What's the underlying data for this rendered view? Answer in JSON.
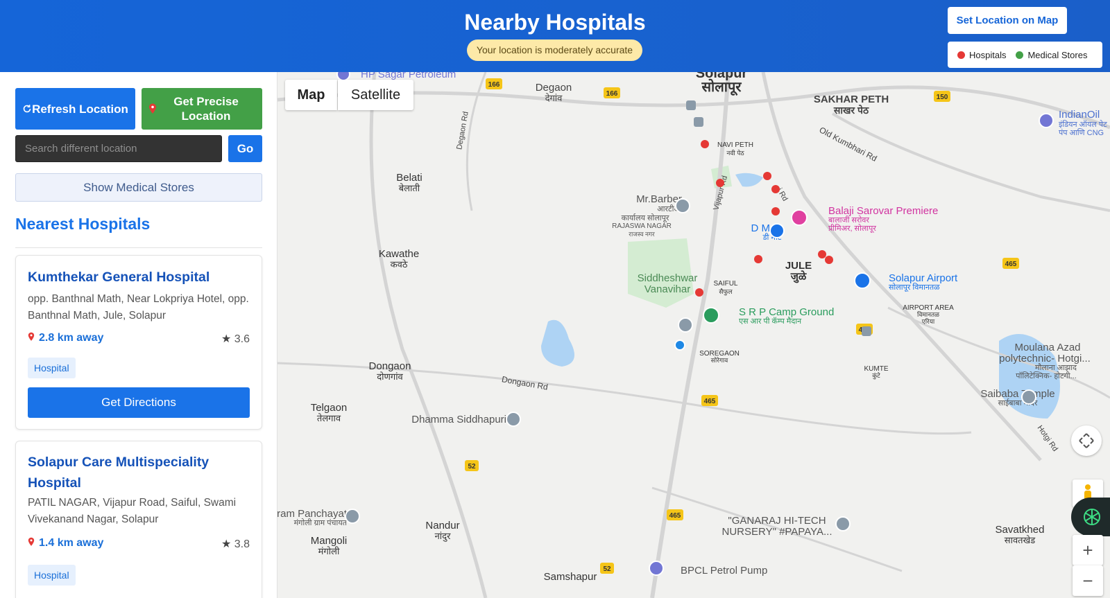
{
  "header": {
    "title": "Nearby Hospitals",
    "accuracy": "Your location is moderately accurate",
    "set_location_button": "Set Location on Map",
    "legend": [
      {
        "label": "Hospitals",
        "color": "#e53935"
      },
      {
        "label": "Medical Stores",
        "color": "#43a047"
      }
    ]
  },
  "sidebar": {
    "refresh_button": "Refresh Location",
    "precise_button": "Get Precise Location",
    "search_placeholder": "Search different location",
    "go_button": "Go",
    "show_stores_button": "Show Medical Stores",
    "section_title": "Nearest Hospitals",
    "hospitals": [
      {
        "name": "Kumthekar General Hospital",
        "address": "opp. Banthnal Math, Near Lokpriya Hotel, opp. Banthnal Math, Jule, Solapur",
        "distance": "2.8 km away",
        "rating": "3.6",
        "tag": "Hospital",
        "directions_button": "Get Directions"
      },
      {
        "name": "Solapur Care Multispeciality Hospital",
        "address": "PATIL NAGAR, Vijapur Road, Saiful, Swami Vivekanand Nagar, Solapur",
        "distance": "1.4 km away",
        "rating": "3.8",
        "tag": "Hospital"
      }
    ]
  },
  "map": {
    "type_buttons": [
      "Map",
      "Satellite"
    ],
    "places": {
      "hp_sagar": "HP Sagar Petroleum",
      "solapur_en": "Solapur",
      "solapur_mr": "सोलापूर",
      "degaon_en": "Degaon",
      "degaon_mr": "देगांव",
      "sakhar_peth_en": "SAKHAR PETH",
      "sakhar_peth_mr": "साखर पेठ",
      "indianoil": "IndianOil",
      "indianoil_mr1": "इंडियन ऑयल पेट",
      "indianoil_mr2": "पंप आणि CNG",
      "navi_peth_en": "NAVI PETH",
      "navi_peth_mr": "नवी पेठ",
      "belati_en": "Belati",
      "belati_mr": "बेलाती",
      "mr_barber": "Mr.Barber",
      "rto_mr1": "आरटीओ",
      "rto_mr2": "कार्यालय सोलापूर",
      "rajaswa_en": "RAJASWA NAGAR",
      "rajaswa_mr": "राजस्व नगर",
      "d_mart_en": "D Mart",
      "d_mart_mr": "डी मार्ट",
      "balaji_en": "Balaji Sarovar Premiere",
      "balaji_mr1": "बालाजी सरोवर",
      "balaji_mr2": "प्रीमिअर, सोलापूर",
      "kawathe_en": "Kawathe",
      "kawathe_mr": "कवठे",
      "jule_en": "JULE",
      "jule_mr": "जुळे",
      "solapur_airport_en": "Solapur Airport",
      "solapur_airport_mr": "सोलापूर विमानतळ",
      "siddheshwar1": "Siddheshwar",
      "siddheshwar2": "Vanavihar",
      "saiful_en": "SAIFUL",
      "saiful_mr": "सैफुल",
      "srp_en": "S R P Camp Ground",
      "srp_mr": "एस आर पी कॅम्प मैदान",
      "airport_area_en": "AIRPORT AREA",
      "airport_area_mr1": "विमानतळ",
      "airport_area_mr2": "एरिया",
      "moulana1": "Moulana Azad",
      "moulana2": "polytechnic- Hotgi...",
      "moulana_mr1": "मौलाना आझाद",
      "moulana_mr2": "पॉलिटेक्निक- होटगी...",
      "soregaon_en": "SOREGAON",
      "soregaon_mr": "सोरेगाव",
      "dongaon_en": "Dongaon",
      "dongaon_mr": "दोणगांव",
      "dongaon_rd": "Dongaon Rd",
      "kumte_en": "KUMTE",
      "kumte_mr": "कुंटे",
      "saibaba_en": "Saibaba Temple",
      "saibaba_mr": "साईबाबा मंदिर",
      "telgaon_en": "Telgaon",
      "telgaon_mr": "तेलगाव",
      "dhamma": "Dhamma Siddhapuri",
      "hotgi_rd": "Hotgi Rd",
      "panchayat_en": "ram Panchayat",
      "panchayat_mr": "मंगोली ग्राम पंचायत",
      "nandur_en": "Nandur",
      "nandur_mr": "नांदुर",
      "ganaraj1": "\"GANARAJ HI-TECH",
      "ganaraj2": "NURSERY\" #PAPAYA...",
      "savatkhed_en": "Savatkhed",
      "savatkhed_mr": "सावतखेड",
      "mangoli_en": "Mangoli",
      "mangoli_mr": "मंगोली",
      "bpcl": "BPCL Petrol Pump",
      "samshapur": "Samshapur",
      "degaon_rd": "Degaon Rd",
      "old_kumbhari_rd": "Old Kumbhari Rd",
      "vijapur_rd": "Vijapur Rd",
      "hotgi_rd2": "i Rd"
    },
    "road_badges": [
      "166",
      "166",
      "150",
      "465",
      "465",
      "465",
      "52",
      "465",
      "52"
    ],
    "hospital_count": 10
  }
}
